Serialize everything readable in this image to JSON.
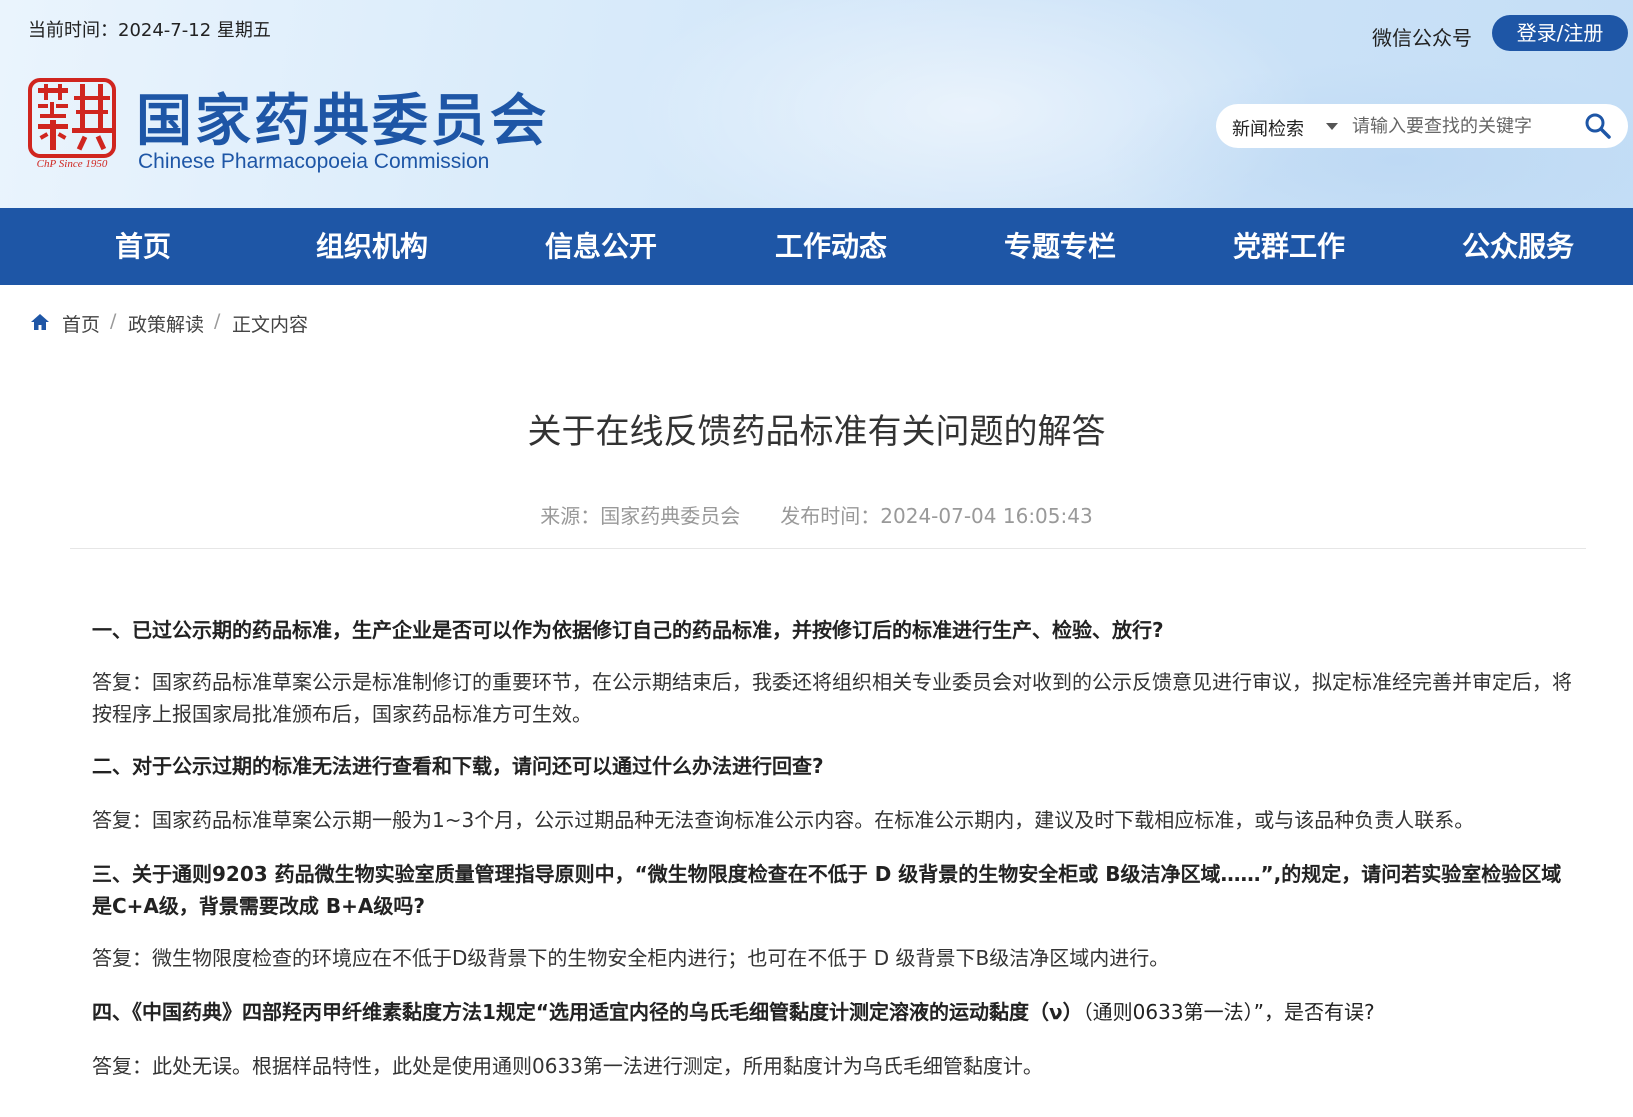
{
  "header": {
    "date": "当前时间：2024-7-12 星期五",
    "wechat": "微信公众号",
    "login": "登录/注册",
    "seal_text": "ChP Since 1950",
    "site_name_cn": "国家药典委员会",
    "site_name_en": "Chinese Pharmacopoeia Commission",
    "search": {
      "scope": "新闻检索",
      "placeholder": "请输入要查找的关键字"
    }
  },
  "nav": {
    "items": [
      {
        "label": "首页"
      },
      {
        "label": "组织机构"
      },
      {
        "label": "信息公开"
      },
      {
        "label": "工作动态"
      },
      {
        "label": "专题专栏"
      },
      {
        "label": "党群工作"
      },
      {
        "label": "公众服务"
      }
    ]
  },
  "breadcrumb": {
    "items": [
      "首页",
      "政策解读",
      "正文内容"
    ],
    "separator": "/"
  },
  "article": {
    "title": "关于在线反馈药品标准有关问题的解答",
    "source": "来源：国家药典委员会",
    "published": "发布时间：2024-07-04 16:05:43",
    "q1": "一、已过公示期的药品标准，生产企业是否可以作为依据修订自己的药品标准，并按修订后的标准进行生产、检验、放行?",
    "a1": "答复：国家药品标准草案公示是标准制修订的重要环节，在公示期结束后，我委还将组织相关专业委员会对收到的公示反馈意见进行审议，拟定标准经完善并审定后，将按程序上报国家局批准颁布后，国家药品标准方可生效。",
    "q2": "二、对于公示过期的标准无法进行查看和下载，请问还可以通过什么办法进行回查?",
    "a2": "答复：国家药品标准草案公示期一般为1~3个月，公示过期品种无法查询标准公示内容。在标准公示期内，建议及时下载相应标准，或与该品种负责人联系。",
    "q3": "三、关于通则9203 药品微生物实验室质量管理指导原则中，“微生物限度检查在不低于 D 级背景的生物安全柜或 B级洁净区域……”,的规定，请问若实验室检验区域是C+A级，背景需要改成 B+A级吗?",
    "a3": "答复：微生物限度检查的环境应在不低于D级背景下的生物安全柜内进行；也可在不低于 D 级背景下B级洁净区域内进行。",
    "q4_bold": "四、《中国药典》四部羟丙甲纤维素黏度方法1规定“选用适宜内径的乌氏毛细管黏度计测定溶液的运动黏度（ν）",
    "q4_normal": "（通则0633第一法）”，是否有误?",
    "a4": "答复：此处无误。根据样品特性，此处是使用通则0633第一法进行测定，所用黏度计为乌氏毛细管黏度计。"
  },
  "colors": {
    "brand_blue": "#1e56a6",
    "seal_red": "#d0251f"
  }
}
